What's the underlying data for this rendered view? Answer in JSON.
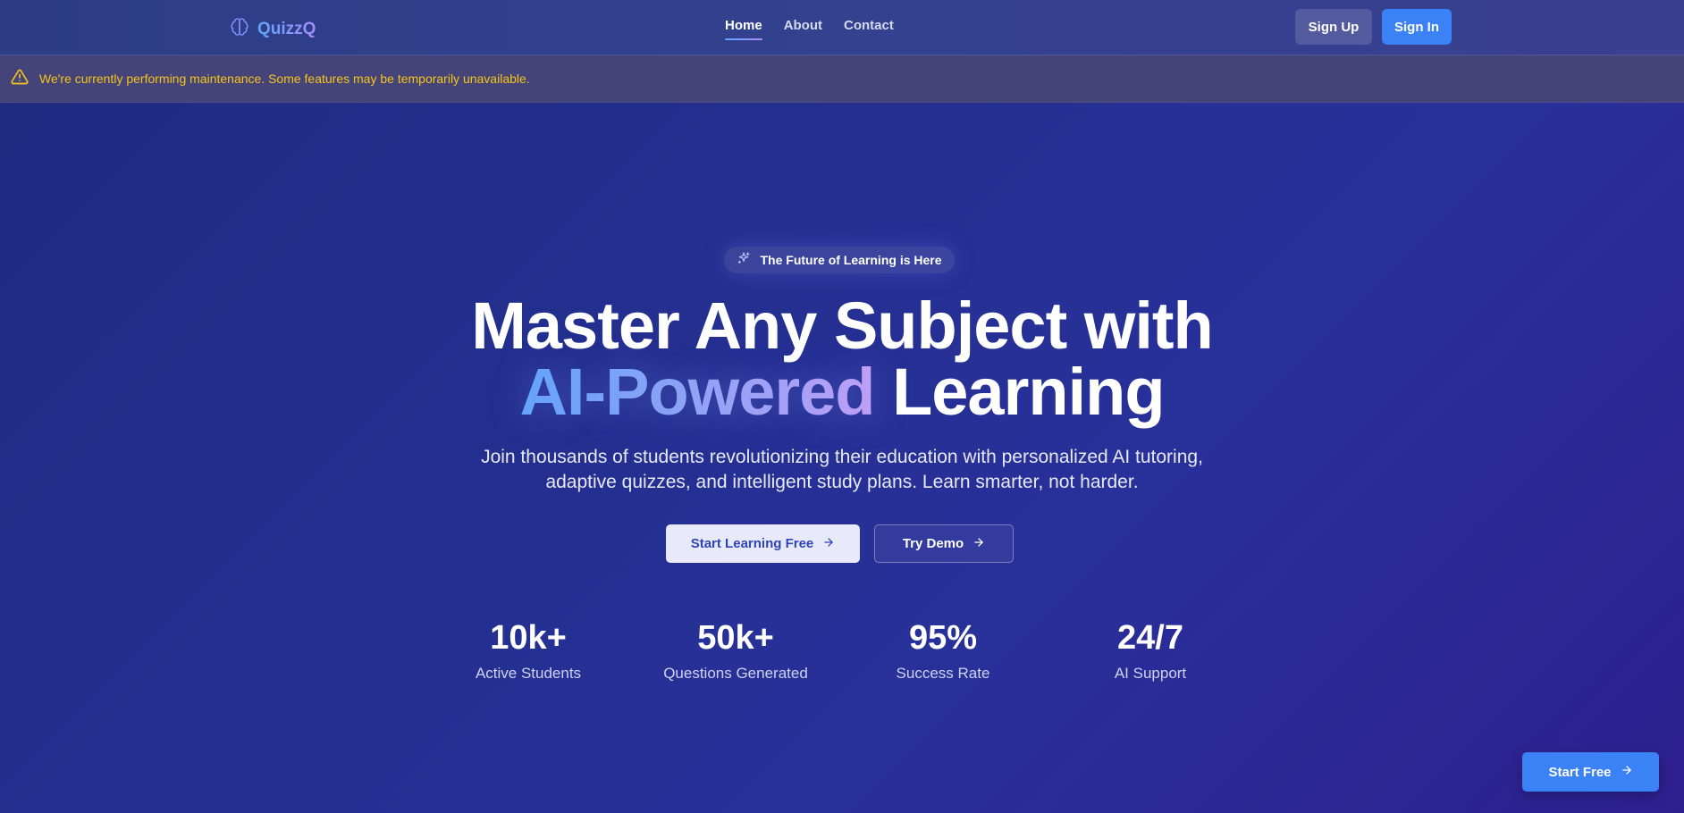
{
  "brand": {
    "name": "QuizzQ",
    "icon": "brain-icon"
  },
  "nav": {
    "links": [
      {
        "label": "Home",
        "active": true
      },
      {
        "label": "About",
        "active": false
      },
      {
        "label": "Contact",
        "active": false
      }
    ],
    "signup_label": "Sign Up",
    "signin_label": "Sign In"
  },
  "alert": {
    "icon": "warning-triangle-icon",
    "text": "We're currently performing maintenance. Some features may be temporarily unavailable."
  },
  "hero": {
    "badge": {
      "icon": "sparkles-icon",
      "text": "The Future of Learning is Here"
    },
    "headline_line1": "Master Any Subject with",
    "headline_highlight": "AI-Powered",
    "headline_line2_rest": "Learning",
    "subtitle": "Join thousands of students revolutionizing their education with personalized AI tutoring, adaptive quizzes, and intelligent study plans. Learn smarter, not harder.",
    "primary_cta": "Start Learning Free",
    "secondary_cta": "Try Demo"
  },
  "stats": [
    {
      "value": "10k+",
      "label": "Active Students"
    },
    {
      "value": "50k+",
      "label": "Questions Generated"
    },
    {
      "value": "95%",
      "label": "Success Rate"
    },
    {
      "value": "24/7",
      "label": "AI Support"
    }
  ],
  "floating_cta": "Start Free",
  "colors": {
    "accent": "#3b82f6",
    "gradient_start": "#60a5fa",
    "gradient_end": "#a78bfa",
    "alert_text": "#f5c518"
  }
}
